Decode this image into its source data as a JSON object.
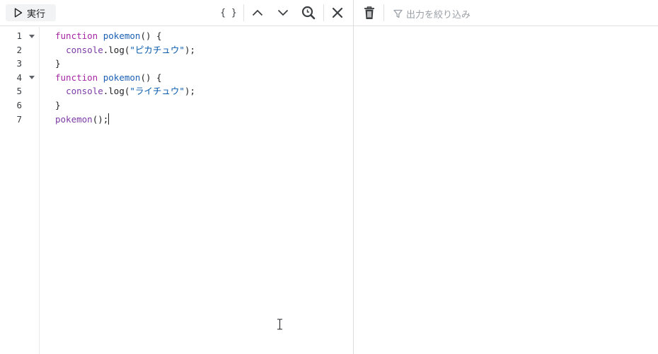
{
  "toolbar": {
    "run_label": "実行",
    "format_label": "{ }",
    "filter_placeholder": "出力を絞り込み"
  },
  "editor": {
    "line_numbers": [
      "1",
      "2",
      "3",
      "4",
      "5",
      "6",
      "7"
    ],
    "folded_lines": [
      1,
      4
    ],
    "lines": [
      [
        {
          "t": "function",
          "c": "kw"
        },
        {
          "t": " ",
          "c": "pl"
        },
        {
          "t": "pokemon",
          "c": "fn"
        },
        {
          "t": "() {",
          "c": "pl"
        }
      ],
      [
        {
          "t": "  ",
          "c": "pl"
        },
        {
          "t": "console",
          "c": "obj"
        },
        {
          "t": ".log(",
          "c": "pl"
        },
        {
          "t": "\"ピカチュウ\"",
          "c": "str"
        },
        {
          "t": ");",
          "c": "pl"
        }
      ],
      [
        {
          "t": "}",
          "c": "pl"
        }
      ],
      [
        {
          "t": "function",
          "c": "kw"
        },
        {
          "t": " ",
          "c": "pl"
        },
        {
          "t": "pokemon",
          "c": "fn"
        },
        {
          "t": "() {",
          "c": "pl"
        }
      ],
      [
        {
          "t": "  ",
          "c": "pl"
        },
        {
          "t": "console",
          "c": "obj"
        },
        {
          "t": ".log(",
          "c": "pl"
        },
        {
          "t": "\"ライチュウ\"",
          "c": "str"
        },
        {
          "t": ");",
          "c": "pl"
        }
      ],
      [
        {
          "t": "}",
          "c": "pl"
        }
      ],
      [
        {
          "t": "pokemon",
          "c": "obj"
        },
        {
          "t": "();",
          "c": "pl"
        }
      ]
    ]
  },
  "colors": {
    "keyword": "#a626a4",
    "function_name": "#1a5fb4",
    "identifier": "#7c3aa6",
    "string": "#0b5cad"
  }
}
